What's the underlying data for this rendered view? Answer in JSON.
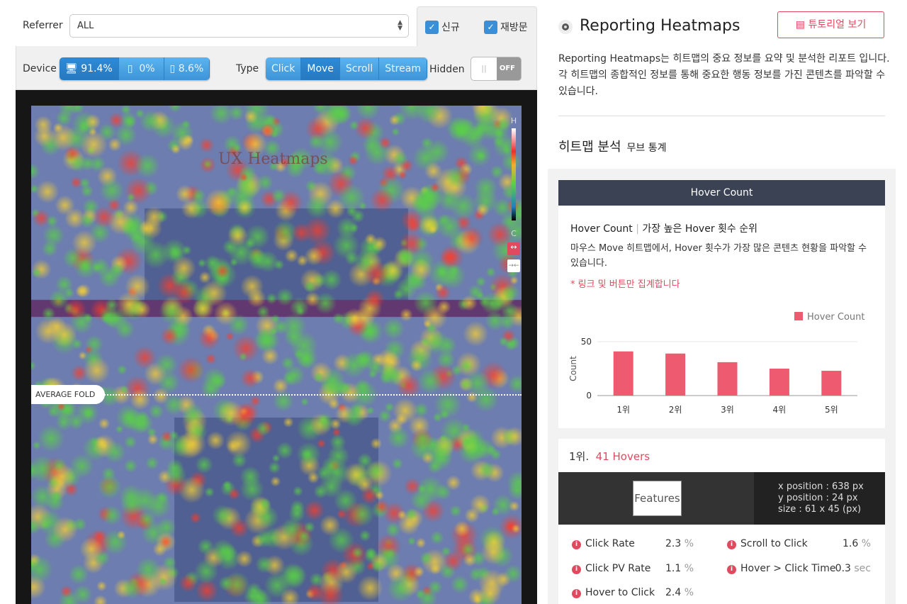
{
  "filters": {
    "referrer_label": "Referrer",
    "referrer_value": "ALL",
    "new_label": "신규",
    "returning_label": "재방문"
  },
  "toolbar": {
    "device_label": "Device",
    "devices": [
      {
        "icon": "desktop-icon",
        "value": "91.4%"
      },
      {
        "icon": "tablet-icon",
        "value": "0%"
      },
      {
        "icon": "mobile-icon",
        "value": "8.6%"
      }
    ],
    "type_label": "Type",
    "types": [
      "Click",
      "Move",
      "Scroll",
      "Stream"
    ],
    "active_type": "Move",
    "hidden_label": "Hidden",
    "hidden_state": "OFF"
  },
  "heatmap": {
    "fold_label": "AVERAGE FOLD",
    "legend_high": "H",
    "legend_low": "C",
    "page_title": "UX Heatmaps"
  },
  "right": {
    "title": "Reporting Heatmaps",
    "tutorial_button": "튜토리얼 보기",
    "description": "Reporting Heatmaps는 히트맵의 중요 정보를 요약 및 분석한 리포트 입니다. 각 히트맵의 종합적인 정보를 통해 중요한 행동 정보를 가진 콘텐츠를 파악할 수 있습니다.",
    "section_title": "히트맵 분석",
    "section_sub": "무브 통계",
    "tab": "Hover Count",
    "card_title": "Hover Count",
    "card_title_sub": "가장 높은 Hover 횟수 순위",
    "card_desc": "마우스 Move 히트맵에서, Hover 횟수가 가장 많은 콘텐츠 현황을 파악할 수 있습니다.",
    "card_note": "* 링크 및 버튼만 집계합니다"
  },
  "chart_data": {
    "type": "bar",
    "categories": [
      "1위",
      "2위",
      "3위",
      "4위",
      "5위"
    ],
    "series": [
      {
        "name": "Hover Count",
        "values": [
          41,
          39,
          31,
          25,
          23
        ]
      }
    ],
    "ylabel": "Count",
    "yticks": [
      0,
      50
    ],
    "ylim": [
      0,
      60
    ],
    "legend": "top-right",
    "color": "#ee5a6f",
    "grid": true
  },
  "rank": {
    "rank_label": "1위.",
    "hovers": "41 Hovers",
    "element_text": "Features",
    "x_position": "x position : 638 px",
    "y_position": "y position : 24 px",
    "size": "size : 61 x 45 (px)",
    "stats": [
      {
        "label": "Click Rate",
        "value": "2.3",
        "unit": "%"
      },
      {
        "label": "Scroll to Click",
        "value": "1.6",
        "unit": "%"
      },
      {
        "label": "Click PV Rate",
        "value": "1.1",
        "unit": "%"
      },
      {
        "label": "Hover > Click Time",
        "value": "0.3",
        "unit": "sec"
      },
      {
        "label": "Hover to Click",
        "value": "2.4",
        "unit": "%"
      }
    ]
  }
}
